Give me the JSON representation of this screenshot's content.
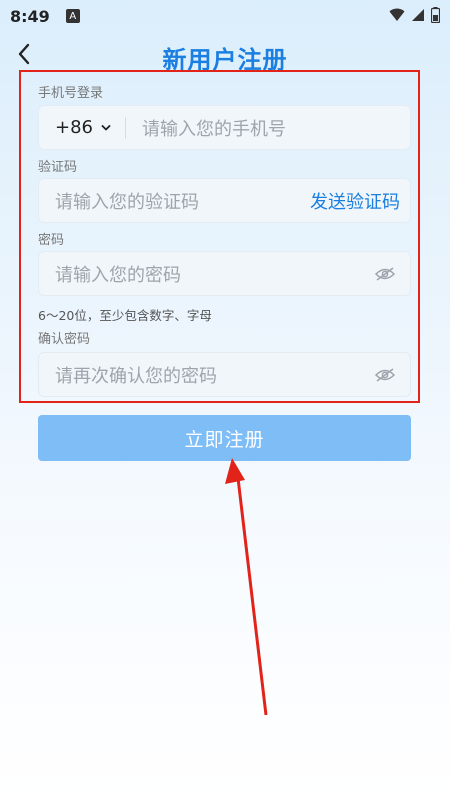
{
  "status_bar": {
    "time": "8:49",
    "notification_badge": "A"
  },
  "header": {
    "title": "新用户注册"
  },
  "form": {
    "phone": {
      "label": "手机号登录",
      "country_code": "+86",
      "placeholder": "请输入您的手机号"
    },
    "code": {
      "label": "验证码",
      "placeholder": "请输入您的验证码",
      "send_button": "发送验证码"
    },
    "password": {
      "label": "密码",
      "placeholder": "请输入您的密码",
      "hint": "6～20位，至少包含数字、字母"
    },
    "confirm": {
      "label": "确认密码",
      "placeholder": "请再次确认您的密码"
    }
  },
  "submit_label": "立即注册",
  "colors": {
    "accent": "#1a7fe0",
    "button": "#7fbdf7",
    "highlight_box": "#e2231a",
    "annotation_arrow": "#e2231a"
  }
}
